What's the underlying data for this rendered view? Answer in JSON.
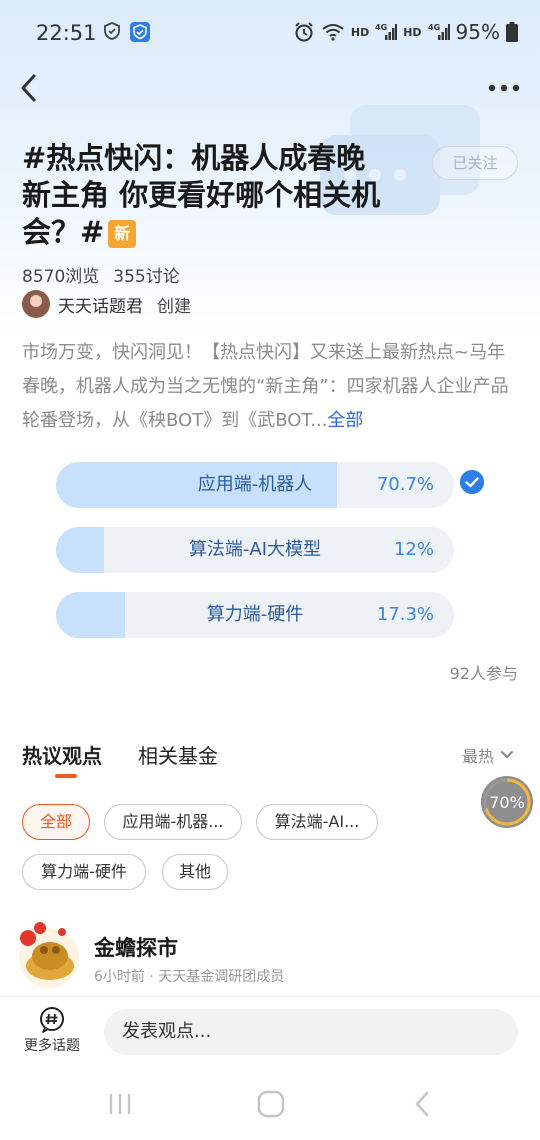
{
  "status_bar": {
    "time": "22:51",
    "network_1": "HD",
    "network_2": "HD",
    "battery": "95%"
  },
  "topic": {
    "title": "#热点快闪：机器人成春晚新主角 你更看好哪个相关机会？#",
    "new_badge": "新",
    "follow_label": "已关注",
    "views": "8570浏览",
    "discussions": "355讨论",
    "creator_name": "天天话题君",
    "creator_role": "创建",
    "description": "市场万变，快闪洞见！【热点快闪】又来送上最新热点~马年春晚，机器人成为当之无愧的“新主角”：四家机器人企业产品轮番登场，从《秧BOT》到《武BOT...",
    "more_label": "全部"
  },
  "poll": {
    "options": [
      {
        "label": "应用端-机器人",
        "percent_text": "70.7%",
        "percent": 70.7,
        "selected": true
      },
      {
        "label": "算法端-AI大模型",
        "percent_text": "12%",
        "percent": 12,
        "selected": false
      },
      {
        "label": "算力端-硬件",
        "percent_text": "17.3%",
        "percent": 17.3,
        "selected": false
      }
    ],
    "participants": "92人参与"
  },
  "tabs": {
    "opinions": "热议观点",
    "funds": "相关基金",
    "sort": "最热"
  },
  "floating_progress": "70%",
  "filters": [
    "全部",
    "应用端-机器...",
    "算法端-AI...",
    "算力端-硬件",
    "其他"
  ],
  "post": {
    "author": "金蟾探市",
    "meta": "6小时前 · 天天基金调研团成员"
  },
  "bottom": {
    "more_topics": "更多话题",
    "input_placeholder": "发表观点..."
  },
  "colors": {
    "accent_orange": "#f05a24",
    "poll_fill": "#c7e0fb",
    "link_blue": "#2d6bcf"
  }
}
